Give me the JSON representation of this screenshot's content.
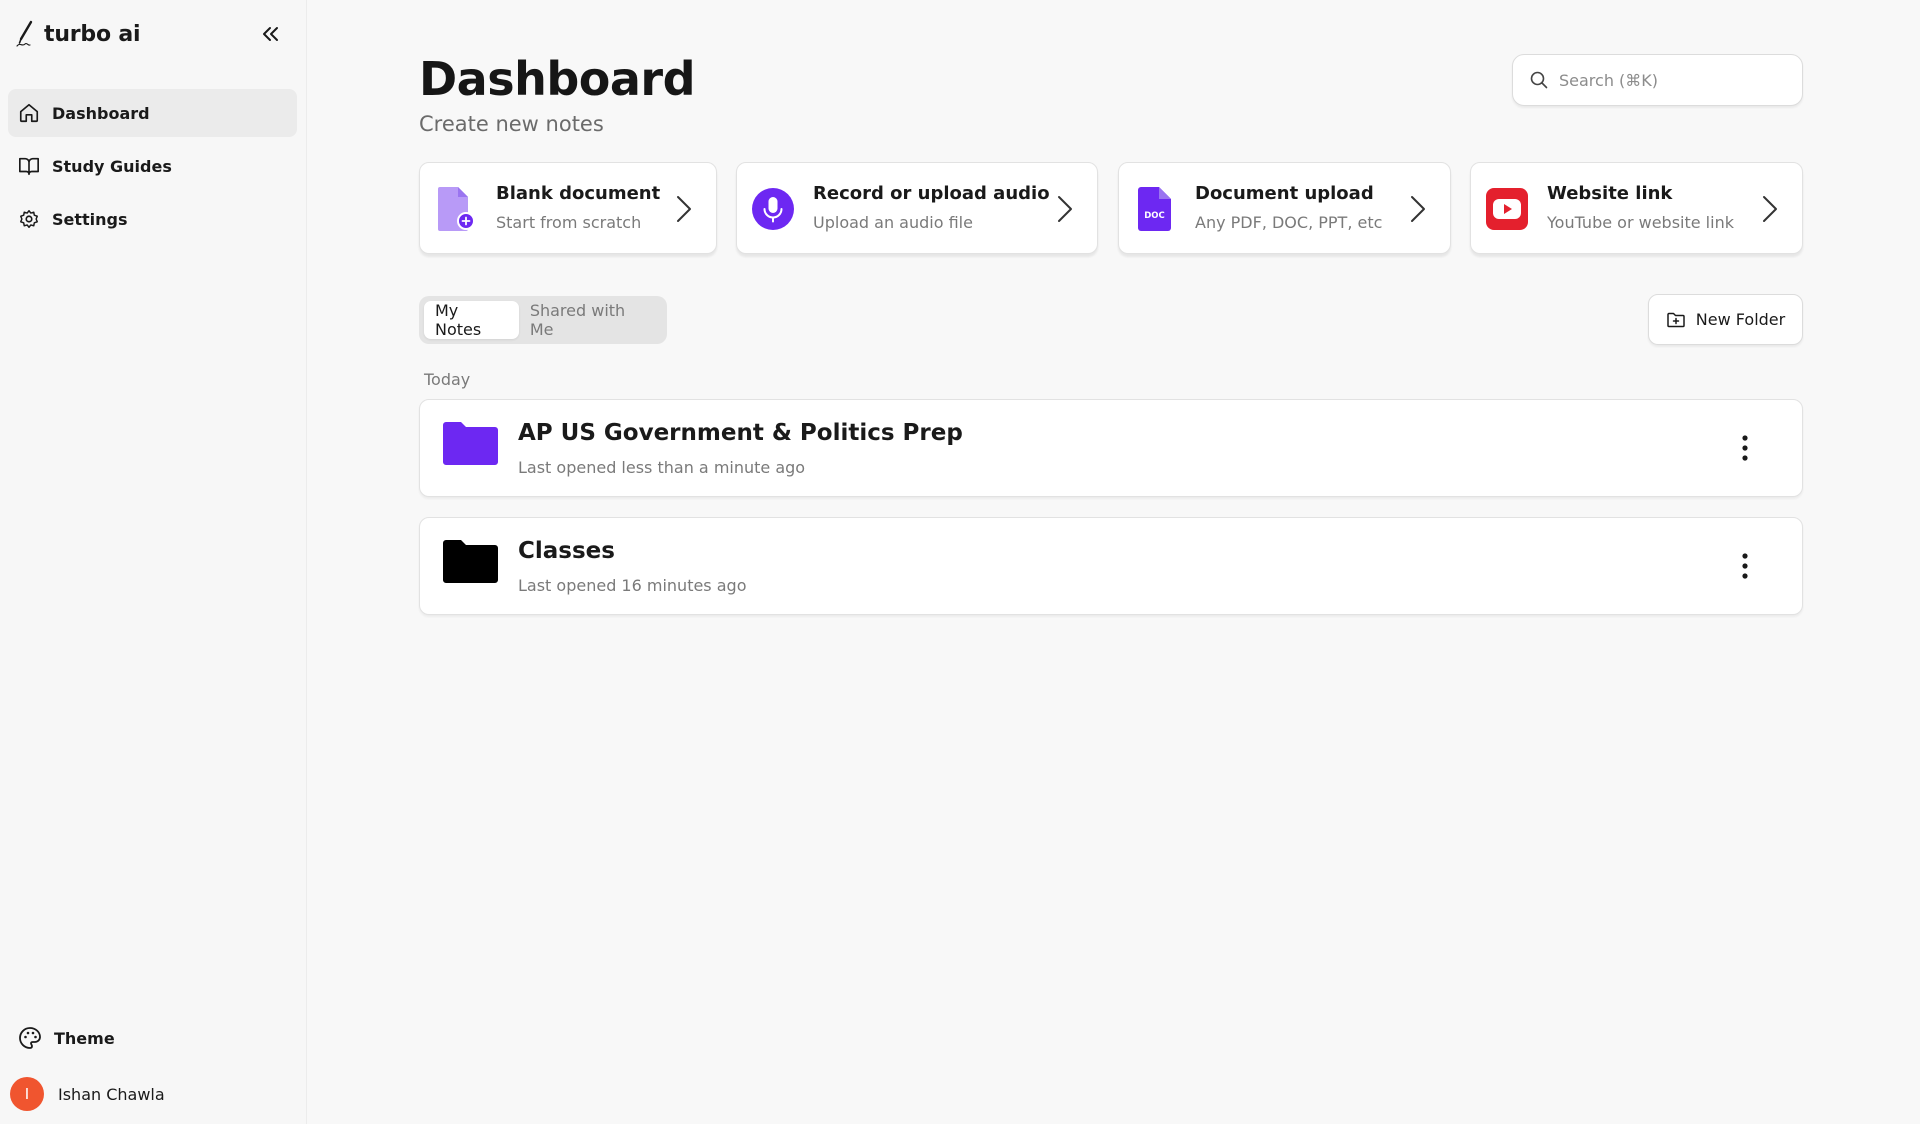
{
  "app": {
    "name": "turbo ai"
  },
  "sidebar": {
    "items": [
      {
        "label": "Dashboard",
        "icon": "home-icon",
        "active": true
      },
      {
        "label": "Study Guides",
        "icon": "book-open-icon",
        "active": false
      },
      {
        "label": "Settings",
        "icon": "gear-icon",
        "active": false
      }
    ],
    "theme_label": "Theme",
    "user": {
      "name": "Ishan Chawla",
      "initial": "I",
      "avatar_color": "#f0552f"
    }
  },
  "header": {
    "title": "Dashboard",
    "subtitle": "Create new notes",
    "search_placeholder": "Search (⌘K)"
  },
  "create_cards": [
    {
      "title": "Blank document",
      "subtitle": "Start from scratch",
      "icon": "blank-document-icon"
    },
    {
      "title": "Record or upload audio",
      "subtitle": "Upload an audio file",
      "icon": "microphone-icon"
    },
    {
      "title": "Document upload",
      "subtitle": "Any PDF, DOC, PPT, etc",
      "icon": "doc-file-icon",
      "icon_text": "DOC"
    },
    {
      "title": "Website link",
      "subtitle": "YouTube or website link",
      "icon": "youtube-icon"
    }
  ],
  "tabs": [
    {
      "label": "My Notes",
      "active": true
    },
    {
      "label": "Shared with Me",
      "active": false
    }
  ],
  "new_folder_label": "New Folder",
  "section_label": "Today",
  "folders": [
    {
      "title": "AP US Government & Politics Prep",
      "subtitle": "Last opened less than a minute ago",
      "color": "#6d28f2"
    },
    {
      "title": "Classes",
      "subtitle": "Last opened 16 minutes ago",
      "color": "#000000"
    }
  ],
  "colors": {
    "accent": "#6d28f2",
    "youtube": "#e4202d",
    "blank_doc": "#b89af7"
  }
}
